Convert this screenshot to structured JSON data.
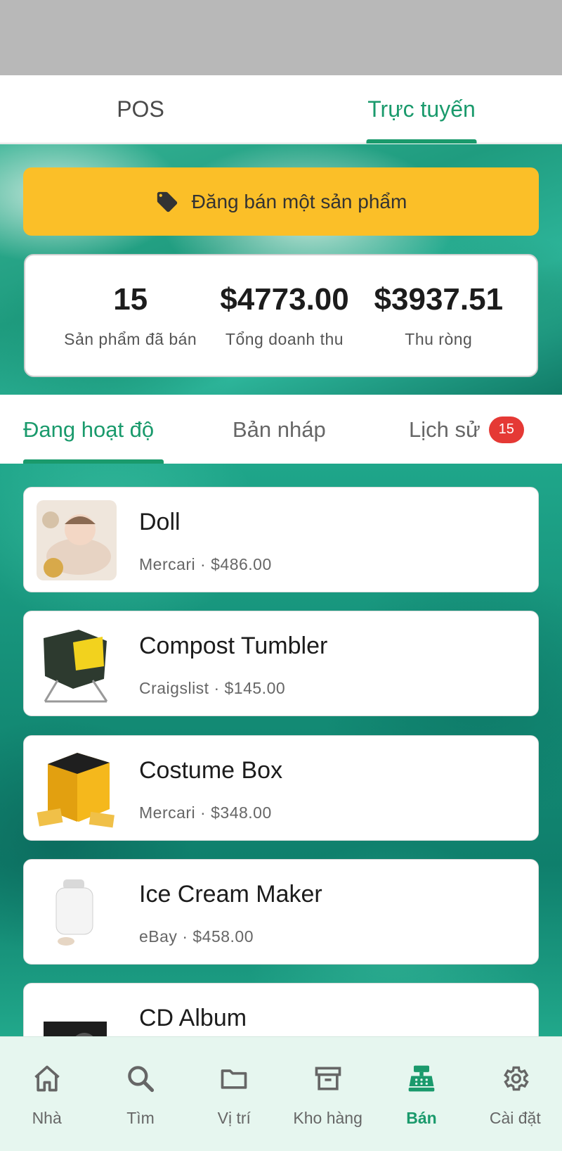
{
  "top_tabs": [
    {
      "label": "POS"
    },
    {
      "label": "Trực tuyến"
    }
  ],
  "sell_button": {
    "label": "Đăng bán một sản phẩm",
    "icon": "tag-icon",
    "color": "#fbbf28"
  },
  "stats": [
    {
      "value": "15",
      "label": "Sản phẩm đã bán"
    },
    {
      "value": "$4773.00",
      "label": "Tổng doanh thu"
    },
    {
      "value": "$3937.51",
      "label": "Thu ròng"
    }
  ],
  "sub_tabs": {
    "active": {
      "label": "Đang hoạt độ"
    },
    "drafts": {
      "label": "Bản nháp"
    },
    "history": {
      "label": "Lịch sử",
      "badge": "15"
    }
  },
  "listings": [
    {
      "title": "Doll",
      "subtitle": "Mercari · $486.00"
    },
    {
      "title": "Compost Tumbler",
      "subtitle": "Craigslist · $145.00"
    },
    {
      "title": "Costume Box",
      "subtitle": "Mercari · $348.00"
    },
    {
      "title": "Ice Cream Maker",
      "subtitle": "eBay · $458.00"
    },
    {
      "title": "CD Album",
      "subtitle": ""
    }
  ],
  "bottom_nav": [
    {
      "label": "Nhà",
      "icon": "home-icon"
    },
    {
      "label": "Tìm",
      "icon": "search-icon"
    },
    {
      "label": "Vị trí",
      "icon": "folder-icon"
    },
    {
      "label": "Kho hàng",
      "icon": "archive-icon"
    },
    {
      "label": "Bán",
      "icon": "cash-register-icon"
    },
    {
      "label": "Cài đặt",
      "icon": "gear-icon"
    }
  ],
  "colors": {
    "accent": "#1a9a6c",
    "badge": "#e53935",
    "nav_bg": "#e6f6ef"
  }
}
